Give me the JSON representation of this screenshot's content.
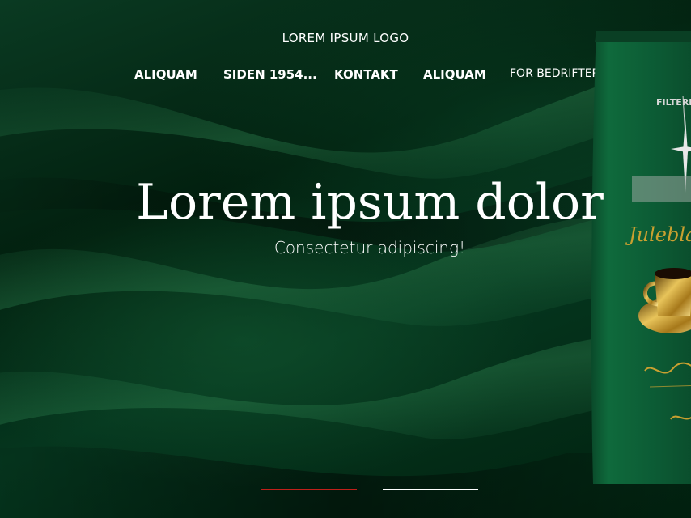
{
  "header": {
    "logo_text": "LOREM IPSUM LOGO"
  },
  "nav": {
    "items": [
      {
        "label": "ALIQUAM"
      },
      {
        "label": "SIDEN 1954..."
      },
      {
        "label": "KONTAKT"
      },
      {
        "label": "ALIQUAM"
      },
      {
        "label": "FOR BEDRIFTER",
        "icon": "external-arrow-icon"
      }
    ]
  },
  "hero": {
    "title": "Lorem ipsum dolor",
    "subtitle": "Consectetur adipiscing!",
    "product": {
      "brand_text": "FILTERMALT",
      "name_script": "Juleblanding",
      "icons": [
        "star-ornament-icon",
        "gold-coffee-cup-icon"
      ]
    }
  },
  "slider": {
    "slides": [
      {
        "active": true
      },
      {
        "active": false
      }
    ],
    "active_color": "#c0201a",
    "inactive_color": "#ffffff"
  },
  "colors": {
    "background": "#02200f",
    "package_green": "#0c5a34",
    "gold": "#c9a030",
    "text": "#ffffff"
  }
}
